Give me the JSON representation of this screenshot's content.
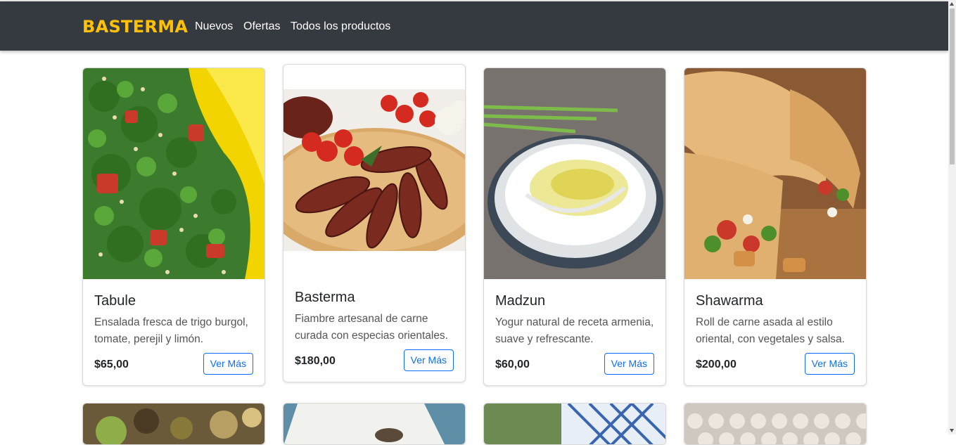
{
  "navbar": {
    "brand": "BASTERMA",
    "links": [
      "Nuevos",
      "Ofertas",
      "Todos los productos"
    ]
  },
  "products": [
    {
      "name": "Tabule",
      "description": "Ensalada fresca de trigo burgol, tomate, perejil y limón.",
      "price": "$65,00",
      "button": "Ver Más"
    },
    {
      "name": "Basterma",
      "description": "Fiambre artesanal de carne curada con especias orientales.",
      "price": "$180,00",
      "button": "Ver Más"
    },
    {
      "name": "Madzun",
      "description": "Yogur natural de receta armenia, suave y refrescante.",
      "price": "$60,00",
      "button": "Ver Más"
    },
    {
      "name": "Shawarma",
      "description": "Roll de carne asada al estilo oriental, con vegetales y salsa.",
      "price": "$200,00",
      "button": "Ver Más"
    }
  ],
  "colors": {
    "navbar_bg": "#343a40",
    "brand": "#ffc107",
    "button_accent": "#0d6efd"
  }
}
